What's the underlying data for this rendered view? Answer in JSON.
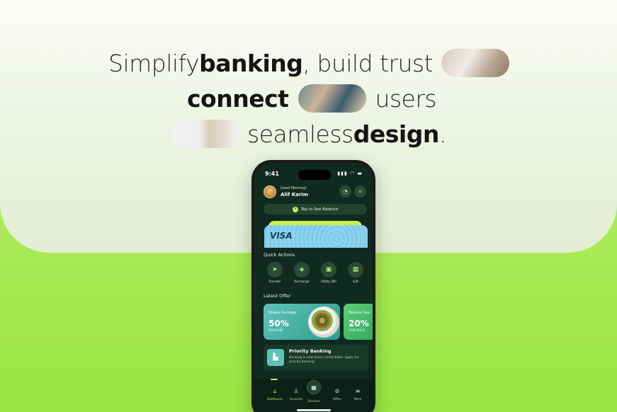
{
  "headline": {
    "l1_a": "Simplify ",
    "l1_b": "banking",
    "l1_c": ", build trust",
    "l2_a": "connect",
    "l2_b": "users",
    "l3_a": "seamless ",
    "l3_b": "design",
    "l3_c": "."
  },
  "status": {
    "time": "9:41",
    "icons": "▮▮▮ ◠ ▬"
  },
  "header": {
    "greeting": "Good Morning!",
    "name": "Alif Karim"
  },
  "balance": {
    "label": "Tap to See Balance"
  },
  "card": {
    "brand": "VISA"
  },
  "quick_actions": {
    "title": "Quick Actions",
    "items": [
      {
        "label": "Transfer",
        "icon": "➤"
      },
      {
        "label": "Recharge",
        "icon": "◈"
      },
      {
        "label": "Utility Bill",
        "icon": "▣"
      },
      {
        "label": "Gift",
        "icon": "▦"
      }
    ]
  },
  "offers": {
    "title": "Latest Offer",
    "items": [
      {
        "name": "Dhaka Heritage",
        "percent": "50%",
        "sub": "DISCOUNT"
      },
      {
        "name": "Festival Spe",
        "percent": "20%",
        "sub": "CASH BACK"
      }
    ]
  },
  "priority": {
    "title": "Priority Banking",
    "desc": "Banking is now more comfortable, apply for priority banking"
  },
  "tabs": [
    {
      "label": "Dashboard",
      "icon": "⌂"
    },
    {
      "label": "Accounts",
      "icon": "♙"
    },
    {
      "label": "Services",
      "icon": "▦"
    },
    {
      "label": "Offers",
      "icon": "⊘"
    },
    {
      "label": "More",
      "icon": "≡"
    }
  ],
  "colors": {
    "accent": "#b8f06a",
    "dark": "#102a1f",
    "background": "#a9ea55"
  }
}
